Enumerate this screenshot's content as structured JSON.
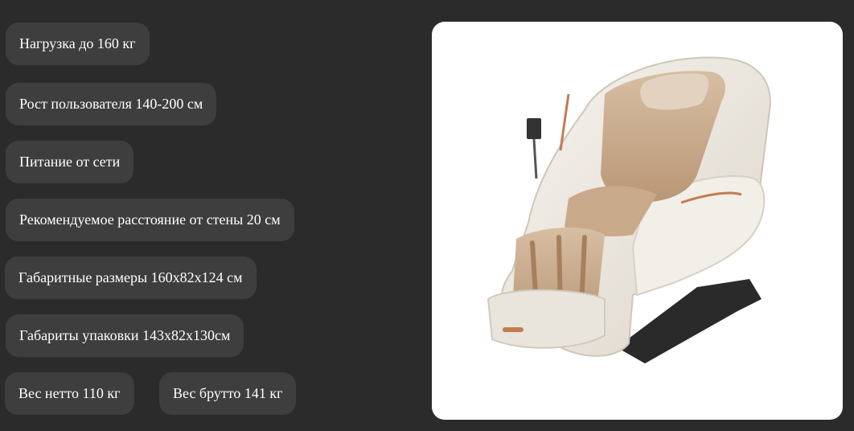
{
  "specs": {
    "load": "Нагрузка до 160 кг",
    "height": "Рост пользователя 140-200 см",
    "power": "Питание от сети",
    "wall_distance": "Рекомендуемое расстояние от стены 20 см",
    "dimensions": "Габаритные размеры 160х82х124 см",
    "package": "Габариты упаковки 143х82х130см",
    "net_weight": "Вес нетто 110 кг",
    "gross_weight": "Вес брутто 141 кг"
  },
  "colors": {
    "page_background": "#2b2b2b",
    "chip_background": "#3e3e3e",
    "chip_text": "#ffffff",
    "photo_background": "#ffffff",
    "chair_shell": "#ece7df",
    "chair_upholstery": "#c9ab8c",
    "chair_accent": "#c27c4f",
    "chair_base": "#2a2a2a"
  },
  "photo": {
    "subject": "massage-chair-icon"
  }
}
